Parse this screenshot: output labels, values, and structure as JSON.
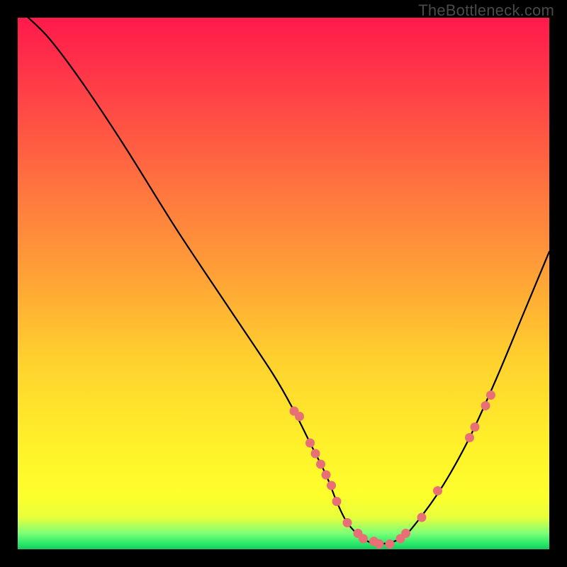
{
  "watermark": "TheBottleneck.com",
  "chart_data": {
    "type": "line",
    "title": "",
    "xlabel": "",
    "ylabel": "",
    "xlim": [
      0,
      100
    ],
    "ylim": [
      0,
      100
    ],
    "grid": false,
    "legend": false,
    "curve": {
      "name": "bottleneck-curve",
      "x": [
        2,
        6,
        12,
        20,
        30,
        40,
        48,
        52,
        55,
        58,
        60,
        62,
        65,
        68,
        72,
        75,
        80,
        85,
        90,
        95,
        100
      ],
      "y": [
        100,
        96,
        88,
        76,
        60,
        45,
        33,
        26,
        20,
        14,
        9,
        5,
        2,
        1,
        2,
        5,
        12,
        21,
        32,
        44,
        56
      ]
    },
    "points": {
      "name": "sample-points",
      "x": [
        52,
        53,
        55,
        56,
        57,
        58,
        59,
        60,
        62,
        64,
        65,
        67,
        68,
        70,
        72,
        73,
        76,
        79,
        85,
        86,
        88,
        89
      ],
      "y": [
        26,
        25,
        20,
        18,
        16,
        14,
        12,
        9,
        5,
        3,
        2,
        1.5,
        1,
        1,
        2,
        3,
        6,
        11,
        21,
        23,
        27,
        29
      ]
    },
    "colors": {
      "gradient_top": "#ff1a4b",
      "gradient_mid": "#ffd02e",
      "gradient_bottom": "#19c95c",
      "curve_stroke": "#000000",
      "point_fill": "#e96f77",
      "background": "#000000"
    }
  }
}
